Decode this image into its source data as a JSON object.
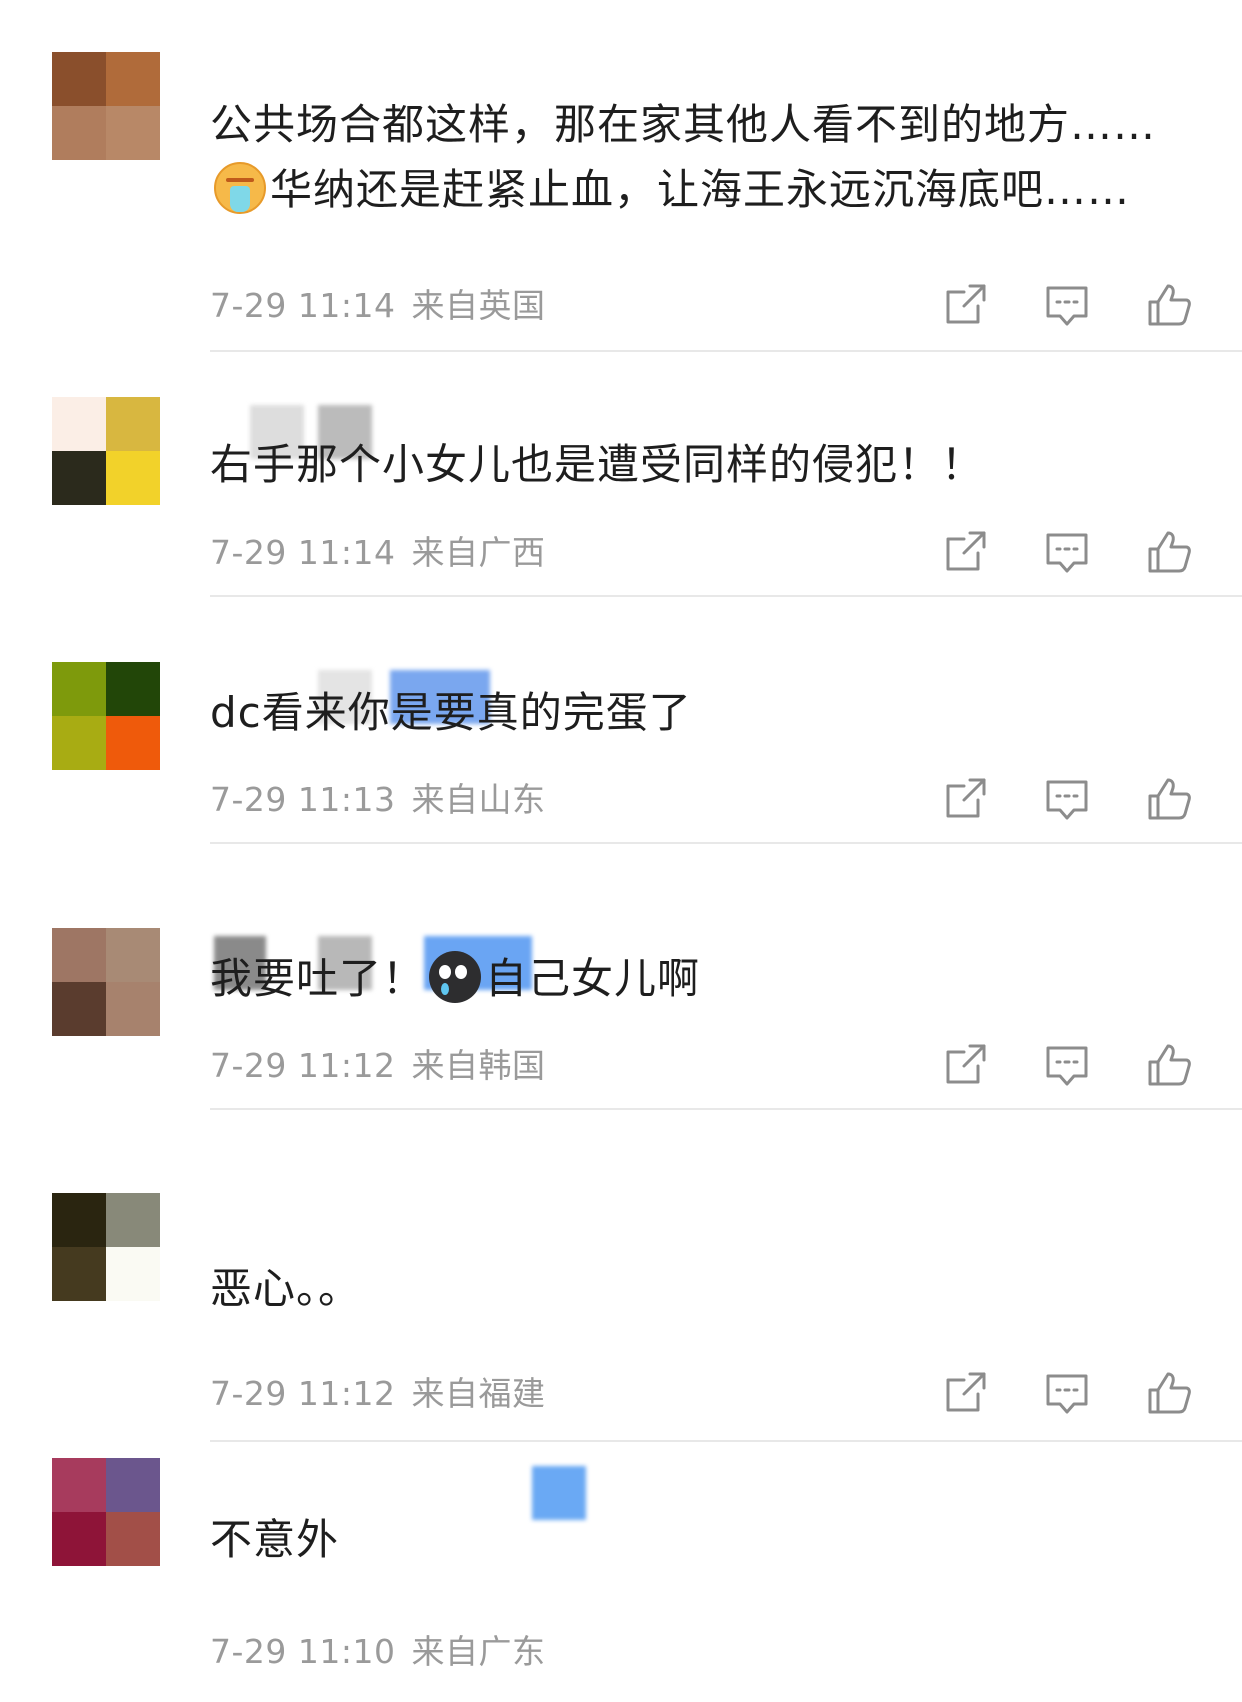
{
  "comments": [
    {
      "avatar_colors": [
        "#8a4f2c",
        "#b06b3a",
        "#b07d5d",
        "#b88867"
      ],
      "username_blocks": [],
      "text_parts": [
        "公共场合都这样，那在家其他人看不到的地方……",
        "华纳还是赶紧止血，让海王永远沉海底吧……"
      ],
      "emoji": "vomit-emoji",
      "time": "7-29 11:14",
      "location": "来自英国"
    },
    {
      "avatar_colors": [
        "#fbeee6",
        "#d8b740",
        "#2b2a1c",
        "#f2d22a"
      ],
      "username_blocks": [
        "#dddddd",
        "#bbbbbb"
      ],
      "text_parts": [
        "右手那个小女儿也是遭受同样的侵犯！！"
      ],
      "emoji": "",
      "time": "7-29 11:14",
      "location": "来自广西"
    },
    {
      "avatar_colors": [
        "#7e9a0c",
        "#224608",
        "#a8ac13",
        "#ef5a0b"
      ],
      "username_blocks": [
        "#e4e4e4",
        "#7aa7ef"
      ],
      "text_parts": [
        "dc看来你是要真的完蛋了"
      ],
      "emoji": "",
      "time": "7-29 11:13",
      "location": "来自山东"
    },
    {
      "avatar_colors": [
        "#9e7664",
        "#a88a75",
        "#5a3c2e",
        "#a7826d"
      ],
      "username_blocks": [
        "#8a8a8a",
        "#b8b8b8",
        "#6aa5f3"
      ],
      "text_parts": [
        "我要吐了！",
        "自己女儿啊"
      ],
      "emoji": "crying-emoji",
      "time": "7-29 11:12",
      "location": "来自韩国"
    },
    {
      "avatar_colors": [
        "#2a2510",
        "#888979",
        "#453a1f",
        "#fafaf3"
      ],
      "username_blocks": [],
      "text_parts": [
        "恶心。。"
      ],
      "emoji": "",
      "time": "7-29 11:12",
      "location": "来自福建"
    },
    {
      "avatar_colors": [
        "#a73b5d",
        "#6b568d",
        "#8e1438",
        "#a24f48"
      ],
      "username_blocks": [
        "#6aa9f4"
      ],
      "text_parts": [
        "不意外"
      ],
      "emoji": "",
      "time": "7-29 11:10",
      "location": "来自广东"
    }
  ],
  "icons": {
    "share": "share-icon",
    "comment": "comment-icon",
    "like": "like-icon"
  },
  "colors": {
    "meta_text": "#9a9a9a",
    "icon_stroke": "#8c8c8c",
    "divider": "#e8e8e8"
  }
}
